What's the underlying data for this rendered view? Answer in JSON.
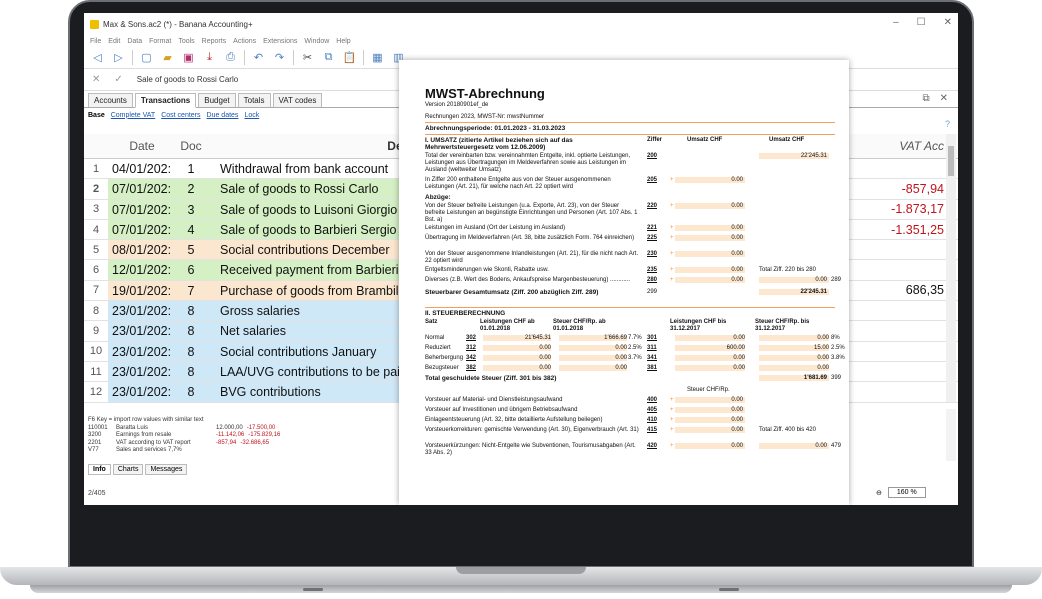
{
  "app": {
    "title": "Max & Sons.ac2 (*) - Banana Accounting+",
    "menu": [
      "File",
      "Edit",
      "Data",
      "Format",
      "Tools",
      "Reports",
      "Actions",
      "Extensions",
      "Window",
      "Help"
    ],
    "cell_edit_value": "Sale of goods to Rossi Carlo"
  },
  "tabs": [
    "Accounts",
    "Transactions",
    "Budget",
    "Totals",
    "VAT codes"
  ],
  "active_tab": "Transactions",
  "views": [
    "Base",
    "Complete VAT",
    "Cost centers",
    "Due dates",
    "Lock"
  ],
  "columns": {
    "date": "Date",
    "doc": "Doc",
    "desc": "Descri",
    "vat": "VAT Acc"
  },
  "rows": [
    {
      "n": "1",
      "date": "04/01/202:",
      "doc": "1",
      "desc": "Withdrawal from bank account",
      "vat": "",
      "color": "#ffffff"
    },
    {
      "n": "2",
      "date": "07/01/202:",
      "doc": "2",
      "desc": "Sale of goods to Rossi Carlo",
      "vat": "-857,94",
      "color": "#d4f0c4"
    },
    {
      "n": "3",
      "date": "07/01/202:",
      "doc": "3",
      "desc": "Sale of goods to Luisoni Giorgio",
      "vat": "-1.873,17",
      "color": "#d4f0c4"
    },
    {
      "n": "4",
      "date": "07/01/202:",
      "doc": "4",
      "desc": "Sale of goods to Barbieri Sergio",
      "vat": "-1.351,25",
      "color": "#d4f0c4"
    },
    {
      "n": "5",
      "date": "08/01/202:",
      "doc": "5",
      "desc": "Social contributions December",
      "vat": "",
      "color": "#fbe7d0"
    },
    {
      "n": "6",
      "date": "12/01/202:",
      "doc": "6",
      "desc": "Received payment from Barbieri",
      "vat": "",
      "color": "#d4f0c4"
    },
    {
      "n": "7",
      "date": "19/01/202:",
      "doc": "7",
      "desc": "Purchase of goods from Brambilla",
      "vat": "686,35",
      "color": "#fbe7d0"
    },
    {
      "n": "8",
      "date": "23/01/202:",
      "doc": "8",
      "desc": "Gross salaries",
      "vat": "",
      "color": "#cfe8f7"
    },
    {
      "n": "9",
      "date": "23/01/202:",
      "doc": "8",
      "desc": "Net salaries",
      "vat": "",
      "color": "#cfe8f7"
    },
    {
      "n": "10",
      "date": "23/01/202:",
      "doc": "8",
      "desc": "Social contributions January",
      "vat": "",
      "color": "#cfe8f7"
    },
    {
      "n": "11",
      "date": "23/01/202:",
      "doc": "8",
      "desc": "LAA/UVG contributions to be paid",
      "vat": "",
      "color": "#cfe8f7"
    },
    {
      "n": "12",
      "date": "23/01/202:",
      "doc": "8",
      "desc": "BVG contributions",
      "vat": "",
      "color": "#cfe8f7"
    }
  ],
  "info": {
    "hint": "F6 Key = import row values with similar text",
    "lines": [
      {
        "code": "110001",
        "name": "Baratta Luis",
        "v1": "12.000,00",
        "v2": "-17.500,00"
      },
      {
        "code": "3200",
        "name": "Earnings from resale",
        "v1": "-11.142,06",
        "v2": "-175.829,16"
      },
      {
        "code": "2201",
        "name": "VAT according to VAT report",
        "v1": "-857,94",
        "v2": "-32.686,65"
      },
      {
        "code": "V77",
        "name": "Sales and services 7,7%",
        "v1": "",
        "v2": ""
      }
    ],
    "tabs": [
      "Info",
      "Charts",
      "Messages"
    ]
  },
  "status": {
    "position": "2/405",
    "zoom": "160 %"
  },
  "report": {
    "title": "MWST-Abrechnung",
    "version": "Version 20180901ef_de",
    "meta": "Rechnungen 2023, MWST-Nr: mwstNummer",
    "period": "Abrechnungsperiode: 01.01.2023 - 31.03.2023",
    "sec1": "I. UMSATZ (zitierte Artikel beziehen sich auf das Mehrwertsteuergesetz vom 12.06.2009)",
    "hdr_ziffer": "Ziffer",
    "hdr_umsatz": "Umsatz CHF",
    "hdr_umsatz2": "Umsatz CHF",
    "abzuege": "Abzüge:",
    "lines1": [
      {
        "lbl": "Total der vereinbarten bzw. vereinnahmten Entgelte, inkl. optierte Leistungen, Leistungen aus Übertragungen im Meldeverfahren sowie aus Leistungen im Ausland (weltweiter Umsatz)",
        "code": "200",
        "val": "",
        "tot": "22'245.31",
        "h": 24
      },
      {
        "lbl": "In Ziffer 200 enthaltene Entgelte aus von der Steuer ausgenommenen Leistungen (Art. 21), für welche nach Art. 22 optiert wird",
        "code": "205",
        "val": "0.00",
        "tot": "",
        "h": 16
      },
      {
        "lbl": "Von der Steuer befreite Leistungen (u.a. Exporte, Art. 23), von der Steuer befreite Leistungen an begünstigte Einrichtungen und Personen (Art. 107 Abs. 1 Bst. a)",
        "code": "220",
        "val": "0.00",
        "tot": "",
        "h": 22
      },
      {
        "lbl": "Leistungen im Ausland (Ort der Leistung im Ausland)",
        "code": "221",
        "val": "0.00",
        "tot": "",
        "h": 10
      },
      {
        "lbl": "Übertragung im Meldeverfahren (Art. 38, bitte zusätzlich Form. 764 einreichen)",
        "code": "225",
        "val": "0.00",
        "tot": "",
        "h": 16
      },
      {
        "lbl": "Von der Steuer ausgenommene Inlandleistungen (Art. 21), für die nicht nach Art. 22 optiert wird",
        "code": "230",
        "val": "0.00",
        "tot": "",
        "h": 16
      },
      {
        "lbl": "Entgeltsminderungen wie Skonti, Rabatte usw.",
        "code": "235",
        "val": "0.00",
        "tot": "Total Ziff. 220 bis 280",
        "h": 10
      },
      {
        "lbl": "Diverses (z.B. Wert des Bodens, Ankaufspreise Margenbesteuerung) ............",
        "code": "280",
        "val": "0.00",
        "tot": "0.00",
        "side": "289",
        "h": 12
      }
    ],
    "steuerbar": "Steuerbarer Gesamtumsatz (Ziff. 200 abzüglich Ziff. 289)",
    "steuerbar_code": "299",
    "steuerbar_val": "22'245.31",
    "sec2": "II. STEUERBERECHNUNG",
    "hdr2": [
      "Satz",
      "Leistungen CHF ab 01.01.2018",
      "Steuer CHF/Rp. ab 01.01.2018",
      "Leistungen CHF bis 31.12.2017",
      "Steuer CHF/Rp. bis 31.12.2017"
    ],
    "rates": [
      {
        "satz": "Normal",
        "c1": "302",
        "l1": "21'645.31",
        "s1": "1'666.69",
        "p1": "7.7%",
        "c2": "301",
        "l2": "0.00",
        "s2": "0.00",
        "p2": "8%"
      },
      {
        "satz": "Reduziert",
        "c1": "312",
        "l1": "0.00",
        "s1": "0.00",
        "p1": "2.5%",
        "c2": "311",
        "l2": "600.00",
        "s2": "15.00",
        "p2": "2.5%"
      },
      {
        "satz": "Beherbergung",
        "c1": "342",
        "l1": "0.00",
        "s1": "0.00",
        "p1": "3.7%",
        "c2": "341",
        "l2": "0.00",
        "s2": "0.00",
        "p2": "3.8%"
      },
      {
        "satz": "Bezugsteuer",
        "c1": "382",
        "l1": "0.00",
        "s1": "0.00",
        "p1": "",
        "c2": "381",
        "l2": "0.00",
        "s2": "0.00",
        "p2": ""
      }
    ],
    "total_steuer": "Total geschuldete Steuer (Ziff. 301 bis 382)",
    "total_steuer_val": "1'681.69",
    "total_steuer_code": "399",
    "steuer_hdr": "Steuer CHF/Rp.",
    "lines2": [
      {
        "lbl": "Vorsteuer auf Material- und Dienstleistungsaufwand",
        "code": "400",
        "val": "0.00",
        "tot": "",
        "h": 10
      },
      {
        "lbl": "Vorsteuer auf Investitionen und übrigem Betriebsaufwand",
        "code": "405",
        "val": "0.00",
        "tot": "",
        "h": 10
      },
      {
        "lbl": "Einlageentsteuerung (Art. 32, bitte detaillierte Aufstellung beilegen)",
        "code": "410",
        "val": "0.00",
        "tot": "",
        "h": 10
      },
      {
        "lbl": "Vorsteuerkorrekturen: gemischte Verwendung (Art. 30), Eigenverbrauch (Art. 31)",
        "code": "415",
        "val": "0.00",
        "tot": "Total Ziff. 400 bis 420",
        "h": 16
      },
      {
        "lbl": "Vorsteuerkürzungen: Nicht-Entgelte wie Subventionen, Tourismusabgaben (Art. 33 Abs. 2)",
        "code": "420",
        "val": "0.00",
        "tot": "0.00",
        "side": "479",
        "h": 16
      }
    ]
  }
}
